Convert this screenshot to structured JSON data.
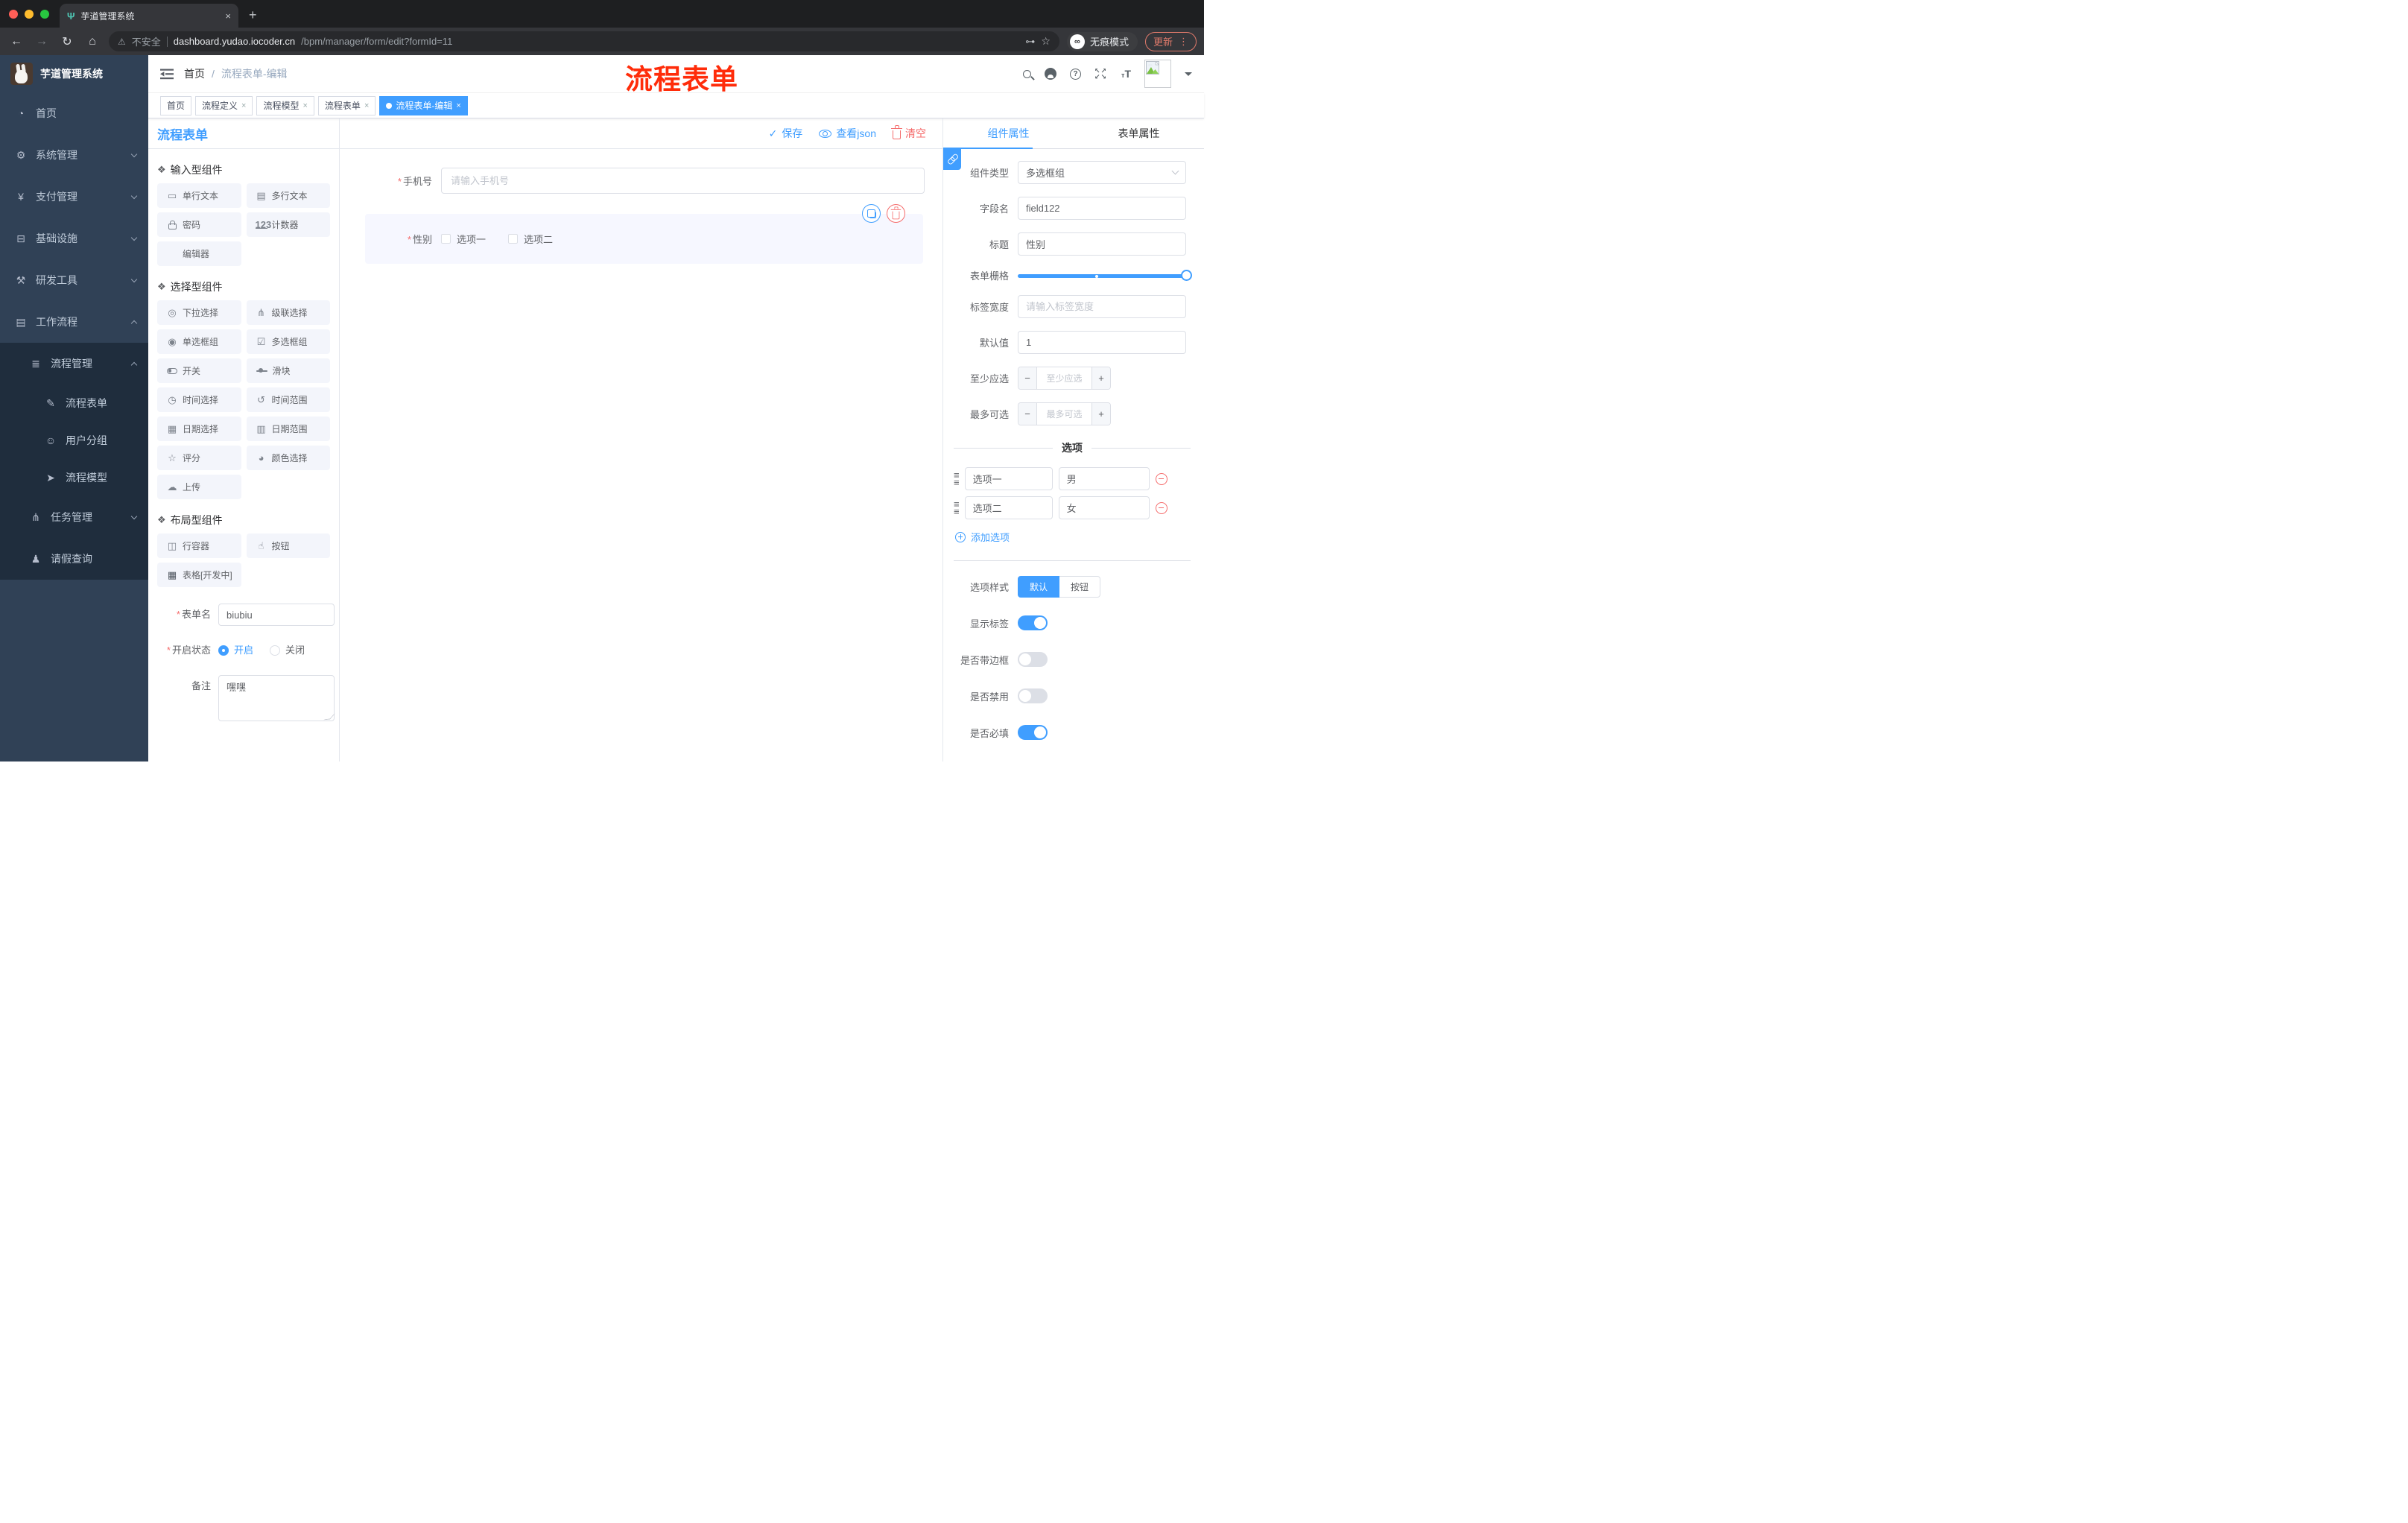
{
  "browser": {
    "tab_title": "芋道管理系统",
    "close_glyph": "×",
    "new_tab_glyph": "+",
    "favicon_glyph": "Ψ",
    "back_glyph": "←",
    "forward_glyph": "→",
    "reload_glyph": "↻",
    "home_glyph": "⌂",
    "warning_glyph": "⚠",
    "security_label": "不安全",
    "url_host": "dashboard.yudao.iocoder.cn",
    "url_path": "/bpm/manager/form/edit?formId=11",
    "key_glyph": "⊶",
    "star_glyph": "☆",
    "incognito_glyph": "∞",
    "incognito_label": "无痕模式",
    "update_label": "更新",
    "kebab_glyph": "⋮"
  },
  "sidebar": {
    "logo_title": "芋道管理系统",
    "menu": [
      {
        "label": "首页",
        "glyph": "◔"
      },
      {
        "label": "系统管理",
        "glyph": "⚙"
      },
      {
        "label": "支付管理",
        "glyph": "¥"
      },
      {
        "label": "基础设施",
        "glyph": "⊟"
      },
      {
        "label": "研发工具",
        "glyph": "⚒"
      },
      {
        "label": "工作流程",
        "glyph": "▤"
      }
    ],
    "submenu": {
      "group_label": "流程管理",
      "group_glyph": "≣",
      "items": [
        {
          "label": "流程表单",
          "glyph": "✎"
        },
        {
          "label": "用户分组",
          "glyph": "☺"
        },
        {
          "label": "流程模型",
          "glyph": "➤"
        }
      ],
      "tasks_label": "任务管理",
      "tasks_glyph": "⋔",
      "leave_label": "请假查询"
    }
  },
  "header": {
    "breadcrumb_home": "首页",
    "breadcrumb_sep": "/",
    "breadcrumb_current": "流程表单-编辑",
    "annotation": "流程表单",
    "fullscreen_glyph": "↖↗ ↙↘",
    "fontsize_small": "т",
    "fontsize_big": "T"
  },
  "tagbar": {
    "tags": [
      {
        "label": "首页",
        "closable": false,
        "active": false
      },
      {
        "label": "流程定义",
        "closable": true,
        "active": false
      },
      {
        "label": "流程模型",
        "closable": true,
        "active": false
      },
      {
        "label": "流程表单",
        "closable": true,
        "active": false
      },
      {
        "label": "流程表单-编辑",
        "closable": true,
        "active": true
      }
    ],
    "close_glyph": "×"
  },
  "leftpanel": {
    "title": "流程表单",
    "section_glyph": "❖",
    "sections": [
      {
        "title": "输入型组件",
        "items": [
          {
            "label": "单行文本",
            "glyph": "▭"
          },
          {
            "label": "多行文本",
            "glyph": "▤"
          },
          {
            "label": "密码",
            "glyph": ""
          },
          {
            "label": "计数器",
            "glyph": "123"
          },
          {
            "label": "编辑器",
            "glyph": ""
          }
        ]
      },
      {
        "title": "选择型组件",
        "items": [
          {
            "label": "下拉选择",
            "glyph": "◎"
          },
          {
            "label": "级联选择",
            "glyph": "⋔"
          },
          {
            "label": "单选框组",
            "glyph": "◉"
          },
          {
            "label": "多选框组",
            "glyph": "☑"
          },
          {
            "label": "开关",
            "glyph": ""
          },
          {
            "label": "滑块",
            "glyph": ""
          },
          {
            "label": "时间选择",
            "glyph": "◷"
          },
          {
            "label": "时间范围",
            "glyph": "↺"
          },
          {
            "label": "日期选择",
            "glyph": "▦"
          },
          {
            "label": "日期范围",
            "glyph": "▥"
          },
          {
            "label": "评分",
            "glyph": "☆"
          },
          {
            "label": "颜色选择",
            "glyph": "◕"
          },
          {
            "label": "上传",
            "glyph": "☁"
          }
        ]
      },
      {
        "title": "布局型组件",
        "items": [
          {
            "label": "行容器",
            "glyph": "◫"
          },
          {
            "label": "按钮",
            "glyph": "☝"
          },
          {
            "label": "表格[开发中]",
            "glyph": "▦"
          }
        ]
      }
    ],
    "form": {
      "name_label": "表单名",
      "name_value": "biubiu",
      "required_star": "*",
      "status_label": "开启状态",
      "status_on": "开启",
      "status_off": "关闭",
      "remark_label": "备注",
      "remark_value": "嘿嘿"
    }
  },
  "canvas": {
    "save_label": "保存",
    "save_glyph": "✓",
    "viewjson_label": "查看json",
    "clear_label": "清空",
    "phone": {
      "required_star": "*",
      "label": "手机号",
      "placeholder": "请输入手机号"
    },
    "gender": {
      "required_star": "*",
      "label": "性别",
      "option1": "选项一",
      "option2": "选项二"
    }
  },
  "inspector": {
    "tab_component": "组件属性",
    "tab_form": "表单属性",
    "rows": {
      "type_label": "组件类型",
      "type_value": "多选框组",
      "field_label": "字段名",
      "field_value": "field122",
      "title_label": "标题",
      "title_value": "性别",
      "grid_label": "表单栅格",
      "labelwidth_label": "标签宽度",
      "labelwidth_placeholder": "请输入标签宽度",
      "default_label": "默认值",
      "default_value": "1",
      "min_label": "至少应选",
      "min_placeholder": "至少应选",
      "max_label": "最多可选",
      "max_placeholder": "最多可选",
      "minus_glyph": "−",
      "plus_glyph": "+"
    },
    "options_divider": "选项",
    "drag_glyph": "≡",
    "options": [
      {
        "name": "选项一",
        "value": "男"
      },
      {
        "name": "选项二",
        "value": "女"
      }
    ],
    "add_option_label": "添加选项",
    "style_label": "选项样式",
    "style_default": "默认",
    "style_button": "按钮",
    "switches": [
      {
        "label": "显示标签",
        "on": true
      },
      {
        "label": "是否带边框",
        "on": false
      },
      {
        "label": "是否禁用",
        "on": false
      },
      {
        "label": "是否必填",
        "on": true
      }
    ]
  }
}
